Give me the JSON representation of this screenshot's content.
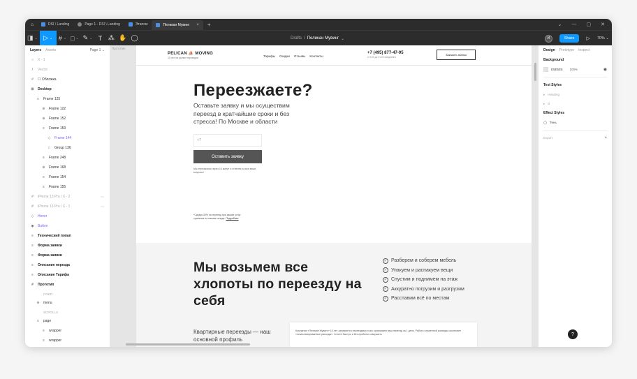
{
  "tabs": {
    "home_icon": "home-icon",
    "items": [
      {
        "label": "DSI \\ Landing",
        "active": false
      },
      {
        "label": "Page 1 - DSI \\ Landing",
        "active": false
      },
      {
        "label": "Этапом",
        "active": false
      },
      {
        "label": "Пеликан Мувинг",
        "active": true
      }
    ],
    "close_glyph": "×",
    "add_glyph": "+"
  },
  "toolbar": {
    "breadcrumb_project": "Drafts",
    "breadcrumb_sep": "/",
    "file_name": "Пеликан Мувинг",
    "file_caret": "⌄",
    "avatar_initial": "И",
    "share_label": "Share",
    "zoom_label": "70% ⌄"
  },
  "left_panel": {
    "tab_layers": "Layers",
    "tab_assets": "Assets",
    "page_selector": "Page 1 ⌄",
    "layers": [
      {
        "icon": "○",
        "label": "X - 1",
        "style": "dim",
        "indent": 0,
        "tag": ""
      },
      {
        "icon": "/",
        "label": "Vector",
        "style": "dim",
        "indent": 0,
        "tag": ""
      },
      {
        "icon": "#",
        "label": "☐ Обложка",
        "style": "",
        "indent": 0,
        "tag": ""
      },
      {
        "icon": "⊞",
        "label": "Desktop",
        "style": "bold",
        "indent": 0,
        "tag": ""
      },
      {
        "icon": "≡",
        "label": "Frame 125",
        "style": "",
        "indent": 1,
        "tag": ""
      },
      {
        "icon": "⊕",
        "label": "Frame 122",
        "style": "",
        "indent": 2,
        "tag": ""
      },
      {
        "icon": "⊕",
        "label": "Frame 152",
        "style": "",
        "indent": 2,
        "tag": ""
      },
      {
        "icon": "≡",
        "label": "Frame 153",
        "style": "",
        "indent": 2,
        "tag": ""
      },
      {
        "icon": "◇",
        "label": "Frame 144",
        "style": "purple",
        "indent": 3,
        "tag": ""
      },
      {
        "icon": "□",
        "label": "Group 136",
        "style": "",
        "indent": 3,
        "tag": ""
      },
      {
        "icon": "≡",
        "label": "Frame 248",
        "style": "",
        "indent": 2,
        "tag": ""
      },
      {
        "icon": "⊕",
        "label": "Frame 168",
        "style": "",
        "indent": 2,
        "tag": ""
      },
      {
        "icon": "≡",
        "label": "Frame 154",
        "style": "",
        "indent": 2,
        "tag": ""
      },
      {
        "icon": "≡",
        "label": "Frame 155",
        "style": "",
        "indent": 2,
        "tag": ""
      },
      {
        "icon": "#",
        "label": "iPhone 13 Pro / X - 2",
        "style": "dim",
        "indent": 0,
        "tag": "〰"
      },
      {
        "icon": "#",
        "label": "iPhone 13 Pro / X - 1",
        "style": "dim",
        "indent": 0,
        "tag": "〰"
      },
      {
        "icon": "◇",
        "label": "Hover",
        "style": "purple",
        "indent": 0,
        "tag": ""
      },
      {
        "icon": "◆",
        "label": "Button",
        "style": "purple",
        "indent": 0,
        "tag": ""
      },
      {
        "icon": "≡",
        "label": "Технический попап",
        "style": "bold",
        "indent": 0,
        "tag": ""
      },
      {
        "icon": "≡",
        "label": "Форма заявки",
        "style": "bold",
        "indent": 0,
        "tag": ""
      },
      {
        "icon": "≡",
        "label": "Форма заявки",
        "style": "bold",
        "indent": 0,
        "tag": ""
      },
      {
        "icon": "≡",
        "label": "Описание перезда",
        "style": "bold",
        "indent": 0,
        "tag": ""
      },
      {
        "icon": "≡",
        "label": "Описание Тарифа",
        "style": "bold",
        "indent": 0,
        "tag": ""
      },
      {
        "icon": "#",
        "label": "Прототип",
        "style": "bold",
        "indent": 0,
        "tag": ""
      },
      {
        "icon": "",
        "label": "FIXED",
        "style": "sec",
        "indent": 1,
        "tag": ""
      },
      {
        "icon": "⊕",
        "label": "menu",
        "style": "",
        "indent": 1,
        "tag": ""
      },
      {
        "icon": "",
        "label": "SCROLLS",
        "style": "sec",
        "indent": 1,
        "tag": ""
      },
      {
        "icon": "≡",
        "label": "page",
        "style": "",
        "indent": 1,
        "tag": ""
      },
      {
        "icon": "≡",
        "label": "wrapper",
        "style": "",
        "indent": 2,
        "tag": ""
      },
      {
        "icon": "≡",
        "label": "wrapper",
        "style": "",
        "indent": 2,
        "tag": ""
      }
    ]
  },
  "canvas": {
    "frame_label": "Прототип",
    "site": {
      "logo_left": "PELICAN",
      "logo_right": "MOVING",
      "logo_tagline": "15 лет на рынке переездов",
      "nav": [
        "Тарифы",
        "Скидки",
        "Отзывы",
        "Контакты"
      ],
      "phone": "+7 (495) 877-47-95",
      "phone_hours": "С 9:00 до 21:00 ежедневно",
      "call_button": "Заказать звонок",
      "hero_title": "Переезжаете?",
      "hero_subtitle": "Оставьте заявку и мы осуществим переезд в кратчайшие сроки и без стресса! По Москве и области",
      "phone_placeholder": "+7",
      "submit_label": "Оставить заявку",
      "submit_note": "Мы перезвоним через 15 минут и ответим на все ваши вопросы!",
      "promo_text": "*Скидка 30% на переезд при заказе услуг хранения на нашем складе.",
      "promo_link": "Подробнее",
      "section_title": "Мы возьмем все хлопоты по переезду на себя",
      "features": [
        "Разберем и соберем мебель",
        "Упакуем и распакуем вещи",
        "Спустим и поднимем на этаж",
        "Аккуратно погрузим и разгрузим",
        "Расставим всё по местам"
      ],
      "check_glyph": "✓",
      "bottom_text": "Квартирные переезды — наш основной профиль",
      "card_text": "Компания «Пеликан Мувинг» 15 лет занимается переездами и мы организуем ваш переезд за 1 день. Работа слаженной команды исключает «незапланированные расходы». Хотите быстро и без проблем совершить"
    }
  },
  "right_panel": {
    "tab_design": "Design",
    "tab_prototype": "Prototype",
    "tab_inspect": "Inspect",
    "background_title": "Background",
    "background_hex": "E5E5E5",
    "background_opacity": "100%",
    "eye_glyph": "◉",
    "text_styles_title": "Text Styles",
    "text_styles": [
      "Heading",
      "B"
    ],
    "effect_styles_title": "Effect Styles",
    "effect_style": "Тень",
    "export_title": "Export",
    "export_add": "+"
  },
  "help_glyph": "?"
}
